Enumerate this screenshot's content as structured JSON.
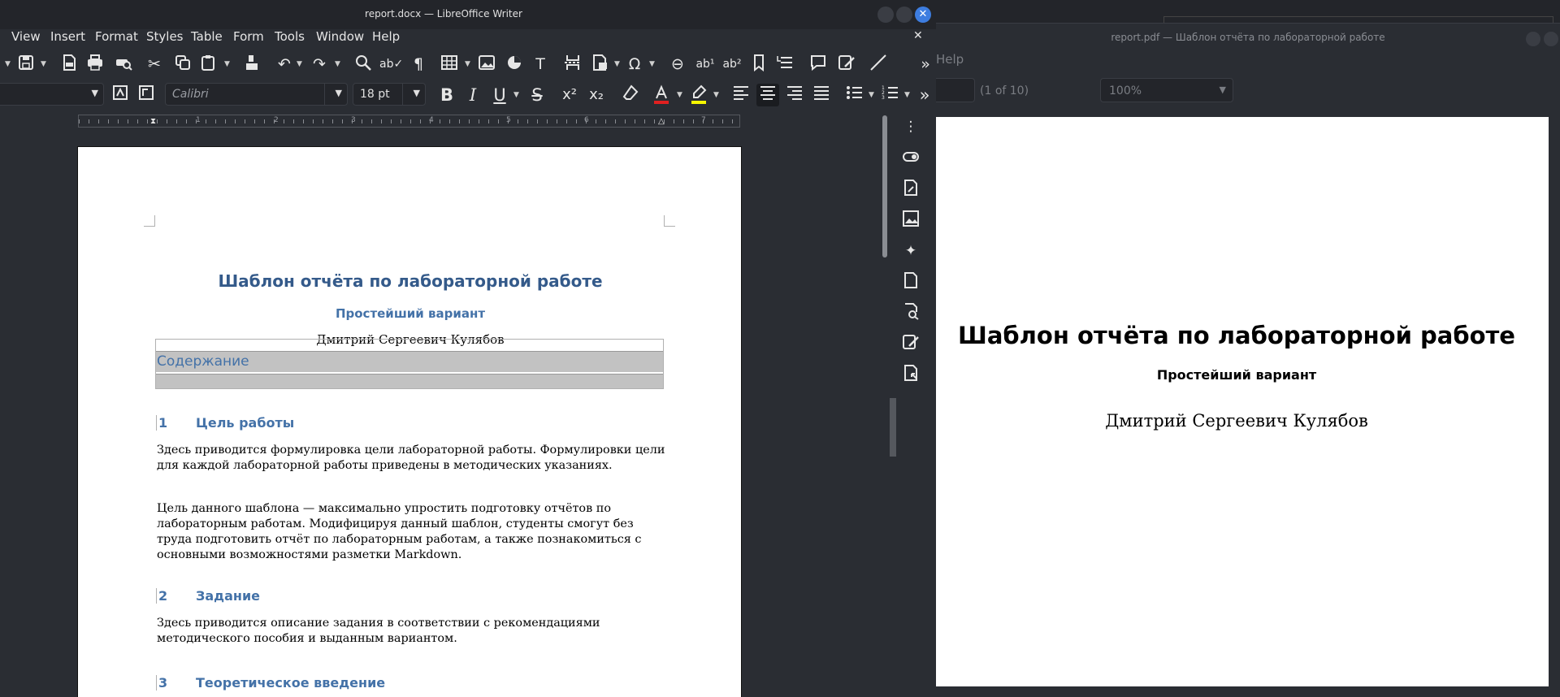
{
  "writer": {
    "title": "report.docx — LibreOffice Writer",
    "close_glyph": "✕",
    "menu": [
      "View",
      "Insert",
      "Format",
      "Styles",
      "Table",
      "Form",
      "Tools",
      "Window",
      "Help"
    ],
    "doc_close_glyph": "✕",
    "font_name": "Calibri",
    "font_size": "18 pt",
    "toolbar_overflow": "»",
    "ruler_labels": [
      "1",
      "1",
      "2",
      "3",
      "4",
      "5",
      "6",
      "7"
    ]
  },
  "document": {
    "title": "Шаблон отчёта по лабораторной работе",
    "subtitle": "Простейший вариант",
    "author": "Дмитрий Сергеевич Кулябов",
    "toc_heading": "Содержание",
    "sections": [
      {
        "number": "1",
        "title": "Цель работы",
        "paragraphs": [
          "Здесь приводится формулировка цели лабораторной работы. Формулировки цели для каждой лабораторной работы приведены в методических указаниях.",
          "Цель данного шаблона — максимально упростить подготовку отчётов по лабораторным работам. Модифицируя данный шаблон, студенты смогут без труда подготовить отчёт по лабораторным работам, а также познакомиться с основными возможностями разметки Markdown."
        ]
      },
      {
        "number": "2",
        "title": "Задание",
        "paragraphs": [
          "Здесь приводится описание задания в соответствии с рекомендациями методического пособия и выданным вариантом."
        ]
      },
      {
        "number": "3",
        "title": "Теоретическое введение",
        "paragraphs": []
      }
    ]
  },
  "pdf_viewer": {
    "title": "report.pdf — Шаблон отчёта по лабораторной работе",
    "menu_help": "Help",
    "page_count": "(1 of 10)",
    "zoom": "100%",
    "page_title": "Шаблон отчёта по лабораторной работе",
    "page_subtitle": "Простейший вариант",
    "page_author": "Дмитрий Сергеевич Кулябов"
  },
  "icons": {
    "accent": "#3d7de0",
    "heading_color": "#345a8a",
    "font_color_bar": "#e02020",
    "highlight_bar": "#f5f500"
  }
}
